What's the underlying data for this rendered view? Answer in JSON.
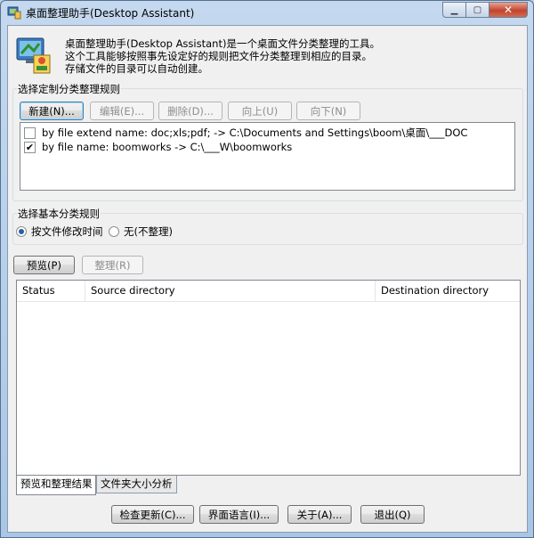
{
  "window": {
    "title": "桌面整理助手(Desktop Assistant)",
    "minimize": "▁",
    "maximize": "▢",
    "close": "✕"
  },
  "intro": {
    "line1": "桌面整理助手(Desktop Assistant)是一个桌面文件分类整理的工具。",
    "line2": "这个工具能够按照事先设定好的规则把文件分类整理到相应的目录。",
    "line3": "存储文件的目录可以自动创建。"
  },
  "custom_rules": {
    "label": "选择定制分类整理规则",
    "buttons": {
      "new": "新建(N)...",
      "edit": "编辑(E)...",
      "delete": "删除(D)...",
      "up": "向上(U)",
      "down": "向下(N)"
    },
    "rules": [
      {
        "checked": false,
        "text": "by file extend name: doc;xls;pdf; -> C:\\Documents and Settings\\boom\\桌面\\___DOC"
      },
      {
        "checked": true,
        "text": "by file name: boomworks -> C:\\___W\\boomworks"
      }
    ]
  },
  "basic_rules": {
    "label": "选择基本分类规则",
    "options": [
      {
        "label": "按文件修改时间",
        "selected": true
      },
      {
        "label": "无(不整理)",
        "selected": false
      }
    ]
  },
  "actions": {
    "preview": "预览(P)",
    "organize": "整理(R)"
  },
  "results_table": {
    "columns": [
      "Status",
      "Source directory",
      "Destination directory"
    ],
    "rows": []
  },
  "tabs": [
    {
      "label": "预览和整理结果",
      "active": true
    },
    {
      "label": "文件夹大小分析",
      "active": false
    }
  ],
  "footer": {
    "check_update": "检查更新(C)...",
    "language": "界面语言(I)...",
    "about": "关于(A)...",
    "exit": "退出(Q)"
  },
  "colors": {
    "title_bar": "#b9d1ea",
    "client_bg": "#f0f0f0",
    "close_button": "#c2442f",
    "radio_dot": "#2a5ea8"
  }
}
